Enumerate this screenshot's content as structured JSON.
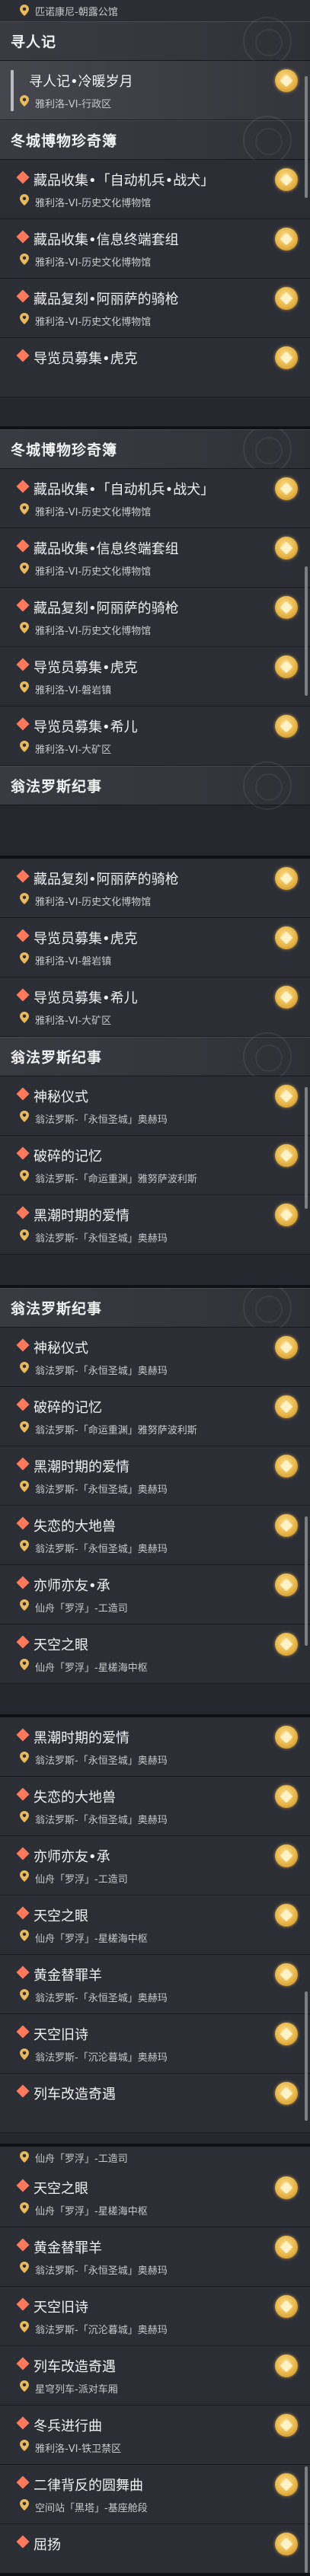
{
  "screenshots": [
    {
      "top_location": "匹诺康尼-朝露公馆",
      "blocks": [
        {
          "kind": "hdr",
          "text": "寻人记"
        },
        {
          "kind": "quest",
          "title": "寻人记•冷暖岁月",
          "sub": "雅利洛-VI-行政区",
          "sel": true
        },
        {
          "kind": "hdr",
          "text": "冬城博物珍奇簿"
        },
        {
          "kind": "quest",
          "title": "藏品收集•「自动机兵•战犬」",
          "sub": "雅利洛-VI-历史文化博物馆",
          "sel": false
        },
        {
          "kind": "quest",
          "title": "藏品收集•信息终端套组",
          "sub": "雅利洛-VI-历史文化博物馆",
          "sel": false
        },
        {
          "kind": "quest",
          "title": "藏品复刻•阿丽萨的骑枪",
          "sub": "雅利洛-VI-历史文化博物馆",
          "sel": false
        },
        {
          "kind": "quest",
          "title": "导览员募集•虎克",
          "sub": "",
          "sel": false
        }
      ]
    },
    {
      "blocks": [
        {
          "kind": "hdr",
          "text": "冬城博物珍奇簿"
        },
        {
          "kind": "quest",
          "title": "藏品收集•「自动机兵•战犬」",
          "sub": "雅利洛-VI-历史文化博物馆",
          "sel": false
        },
        {
          "kind": "quest",
          "title": "藏品收集•信息终端套组",
          "sub": "雅利洛-VI-历史文化博物馆",
          "sel": false
        },
        {
          "kind": "quest",
          "title": "藏品复刻•阿丽萨的骑枪",
          "sub": "雅利洛-VI-历史文化博物馆",
          "sel": false
        },
        {
          "kind": "quest",
          "title": "导览员募集•虎克",
          "sub": "雅利洛-VI-磐岩镇",
          "sel": false
        },
        {
          "kind": "quest",
          "title": "导览员募集•希儿",
          "sub": "雅利洛-VI-大矿区",
          "sel": false
        },
        {
          "kind": "hdr",
          "text": "翁法罗斯纪事"
        }
      ]
    },
    {
      "blocks": [
        {
          "kind": "quest",
          "title": "藏品复刻•阿丽萨的骑枪",
          "sub": "雅利洛-VI-历史文化博物馆",
          "sel": false
        },
        {
          "kind": "quest",
          "title": "导览员募集•虎克",
          "sub": "雅利洛-VI-磐岩镇",
          "sel": false
        },
        {
          "kind": "quest",
          "title": "导览员募集•希儿",
          "sub": "雅利洛-VI-大矿区",
          "sel": false
        },
        {
          "kind": "hdr",
          "text": "翁法罗斯纪事"
        },
        {
          "kind": "quest",
          "title": "神秘仪式",
          "sub": "翁法罗斯-「永恒圣城」奥赫玛",
          "sel": false
        },
        {
          "kind": "quest",
          "title": "破碎的记忆",
          "sub": "翁法罗斯-「命运重渊」雅努萨波利斯",
          "sel": false
        },
        {
          "kind": "quest",
          "title": "黑潮时期的爱情",
          "sub": "翁法罗斯-「永恒圣城」奥赫玛",
          "sel": false
        }
      ]
    },
    {
      "blocks": [
        {
          "kind": "hdr",
          "text": "翁法罗斯纪事"
        },
        {
          "kind": "quest",
          "title": "神秘仪式",
          "sub": "翁法罗斯-「永恒圣城」奥赫玛",
          "sel": false
        },
        {
          "kind": "quest",
          "title": "破碎的记忆",
          "sub": "翁法罗斯-「命运重渊」雅努萨波利斯",
          "sel": false
        },
        {
          "kind": "quest",
          "title": "黑潮时期的爱情",
          "sub": "翁法罗斯-「永恒圣城」奥赫玛",
          "sel": false
        },
        {
          "kind": "quest",
          "title": "失恋的大地兽",
          "sub": "翁法罗斯-「永恒圣城」奥赫玛",
          "sel": false
        },
        {
          "kind": "quest",
          "title": "亦师亦友•承",
          "sub": "仙舟「罗浮」-工造司",
          "sel": false
        },
        {
          "kind": "quest",
          "title": "天空之眼",
          "sub": "仙舟「罗浮」-星槎海中枢",
          "sel": false
        }
      ]
    },
    {
      "blocks": [
        {
          "kind": "quest",
          "title": "黑潮时期的爱情",
          "sub": "翁法罗斯-「永恒圣城」奥赫玛",
          "sel": false
        },
        {
          "kind": "quest",
          "title": "失恋的大地兽",
          "sub": "翁法罗斯-「永恒圣城」奥赫玛",
          "sel": false
        },
        {
          "kind": "quest",
          "title": "亦师亦友•承",
          "sub": "仙舟「罗浮」-工造司",
          "sel": false
        },
        {
          "kind": "quest",
          "title": "天空之眼",
          "sub": "仙舟「罗浮」-星槎海中枢",
          "sel": false
        },
        {
          "kind": "quest",
          "title": "黄金替罪羊",
          "sub": "翁法罗斯-「永恒圣城」奥赫玛",
          "sel": false
        },
        {
          "kind": "quest",
          "title": "天空旧诗",
          "sub": "翁法罗斯-「沉沦暮城」奥赫玛",
          "sel": false
        },
        {
          "kind": "quest",
          "title": "列车改造奇遇",
          "sub": "",
          "sel": false
        }
      ]
    },
    {
      "top_location": "仙舟「罗浮」-工造司",
      "blocks": [
        {
          "kind": "quest",
          "title": "天空之眼",
          "sub": "仙舟「罗浮」-星槎海中枢",
          "sel": false
        },
        {
          "kind": "quest",
          "title": "黄金替罪羊",
          "sub": "翁法罗斯-「永恒圣城」奥赫玛",
          "sel": false
        },
        {
          "kind": "quest",
          "title": "天空旧诗",
          "sub": "翁法罗斯-「沉沦暮城」奥赫玛",
          "sel": false
        },
        {
          "kind": "quest",
          "title": "列车改造奇遇",
          "sub": "星穹列车-派对车厢",
          "sel": false
        },
        {
          "kind": "quest",
          "title": "冬兵进行曲",
          "sub": "雅利洛-VI-铁卫禁区",
          "sel": false
        },
        {
          "kind": "quest",
          "title": "二律背反的圆舞曲",
          "sub": "空间站「黑塔」-基座舱段",
          "sel": false
        },
        {
          "kind": "quest",
          "title": "屈扬",
          "sub": "",
          "sel": false
        }
      ]
    }
  ]
}
